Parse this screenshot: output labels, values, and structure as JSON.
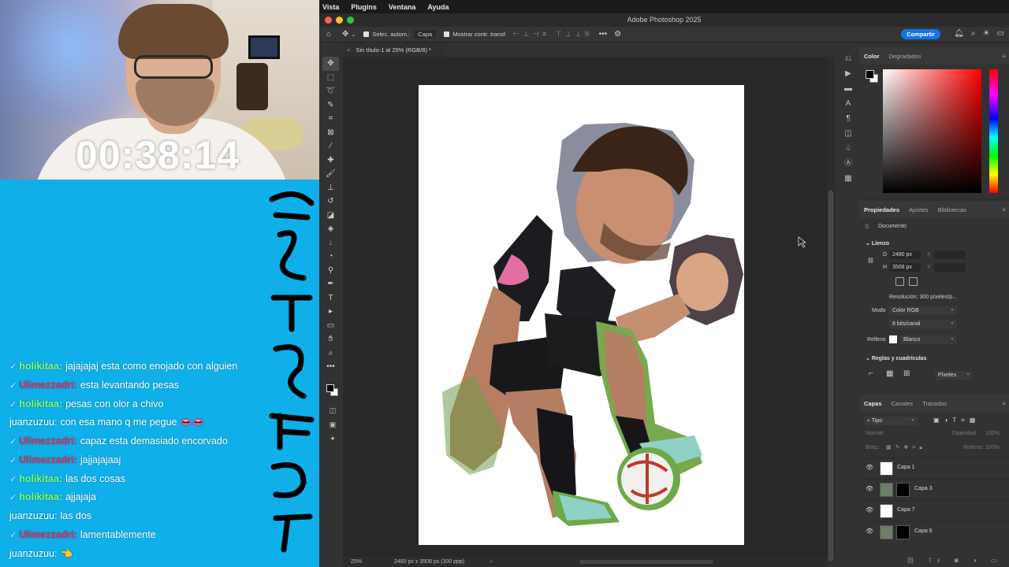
{
  "overlay": {
    "timer": "00:38:14",
    "chat": [
      {
        "badge": true,
        "user": "holikitaa:",
        "user_color": "green",
        "text": "jajajajaj esta como enojado con alguien"
      },
      {
        "badge": true,
        "user": "Ulimezzadri:",
        "user_color": "red",
        "text": "esta levantando pesas"
      },
      {
        "badge": true,
        "user": "holikitaa:",
        "user_color": "green",
        "text": "pesas con olor a chivo"
      },
      {
        "badge": false,
        "user": "juanzuzuu:",
        "user_color": "white",
        "text": "con esa mano q me pegue 👄👄"
      },
      {
        "badge": true,
        "user": "Ulimezzadri:",
        "user_color": "red",
        "text": "capaz esta demasiado encorvado"
      },
      {
        "badge": true,
        "user": "Ulimezzadri:",
        "user_color": "red",
        "text": "jajjajajaaj"
      },
      {
        "badge": true,
        "user": "holikitaa:",
        "user_color": "green",
        "text": "las dos cosas"
      },
      {
        "badge": true,
        "user": "holikitaa:",
        "user_color": "green",
        "text": "ajjajaja"
      },
      {
        "badge": false,
        "user": "juanzuzuu:",
        "user_color": "white",
        "text": "las dos"
      },
      {
        "badge": true,
        "user": "Ulimezzadri:",
        "user_color": "red",
        "text": "lamentablemente"
      },
      {
        "badge": false,
        "user": "juanzuzuu:",
        "user_color": "white",
        "text": "👈"
      }
    ]
  },
  "photoshop": {
    "menu": [
      "Vista",
      "Plugins",
      "Ventana",
      "Ayuda"
    ],
    "window_title": "Adobe Photoshop 2025",
    "options": {
      "auto_select_label": "Selec. autom.:",
      "auto_select_value": "Capa",
      "show_transform_label": "Mostrar contr. transf."
    },
    "share_label": "Compartir",
    "doc_tab": "Sin título-1 al 25% (RGB/8) *",
    "status": {
      "zoom": "25%",
      "info": "2480 px x 3508 px (300 ppp)"
    },
    "color_panel": {
      "tabs": [
        "Color",
        "Degradados"
      ]
    },
    "properties": {
      "tabs": [
        "Propiedades",
        "Ajustes",
        "Bibliotecas"
      ],
      "doc_label": "Documento",
      "canvas_section": "Lienzo",
      "width_label": "D",
      "width_value": "2480 px",
      "height_label": "H",
      "height_value": "3508 px",
      "x_label": "X",
      "y_label": "Y",
      "resolution": "Resolución: 300 píxeles/p...",
      "mode_label": "Modo",
      "mode_value": "Color RGB",
      "depth_value": "8 bits/canal",
      "fill_label": "Relleno",
      "fill_value": "Blanco",
      "rulers_section": "Reglas y cuadrículas",
      "units_value": "Píxeles"
    },
    "layers_panel": {
      "tabs": [
        "Capas",
        "Canales",
        "Trazados"
      ],
      "filter_label": "Tipo",
      "blend_mode": "Normal",
      "opacity_label": "Opacidad:",
      "opacity_value": "100%",
      "lock_label": "Bloq.:",
      "fill_label": "Relleno:",
      "fill_value": "100%",
      "layers": [
        {
          "name": "Capa 1",
          "has_mask": false
        },
        {
          "name": "Capa 3",
          "has_mask": true
        },
        {
          "name": "Capa 7",
          "has_mask": false
        },
        {
          "name": "Capa 6",
          "has_mask": true
        }
      ]
    }
  }
}
